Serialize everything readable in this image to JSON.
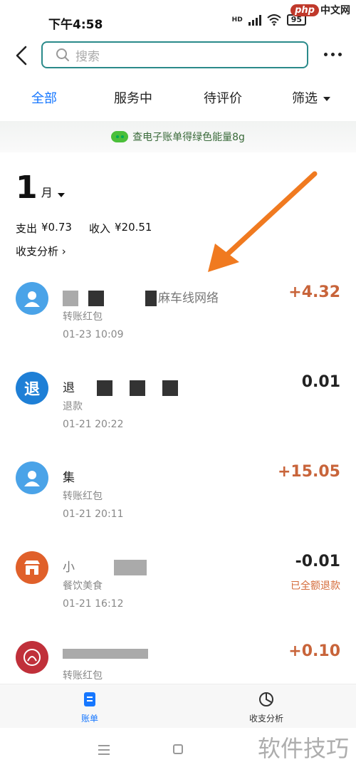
{
  "status_bar": {
    "time": "下午4:58",
    "network": "HD",
    "battery": "95",
    "watermark_logo": "php",
    "watermark_logo_text": "中文网"
  },
  "header": {
    "search_placeholder": "搜索",
    "back_icon": "chevron-left-icon",
    "more_icon": "more-dots-icon"
  },
  "tabs": [
    {
      "label": "全部",
      "active": true
    },
    {
      "label": "服务中",
      "active": false
    },
    {
      "label": "待评价",
      "active": false
    },
    {
      "label": "筛选",
      "active": false
    }
  ],
  "banner": {
    "text": "查电子账单得绿色能量8g"
  },
  "month": {
    "number": "1",
    "unit": "月"
  },
  "summary": {
    "expense_label": "支出",
    "expense_value": "¥0.73",
    "income_label": "收入",
    "income_value": "¥20.51",
    "analysis_link": "收支分析 ›"
  },
  "transactions": [
    {
      "name_visible": "麻车线网络",
      "category": "转账红包",
      "time": "01-23  10:09",
      "amount": "+4.32",
      "note": "",
      "avatar": "user-icon",
      "avatar_color": "#4aa3e8"
    },
    {
      "name_visible": "退",
      "category": "退款",
      "time": "01-21  20:22",
      "amount": "0.01",
      "note": "",
      "avatar": "refund-icon",
      "avatar_text": "退",
      "avatar_color": "#1e7fd6"
    },
    {
      "name_visible": "集",
      "category": "转账红包",
      "time": "01-21  20:11",
      "amount": "+15.05",
      "note": "",
      "avatar": "user-icon",
      "avatar_color": "#4aa3e8"
    },
    {
      "name_visible": "小",
      "category": "餐饮美食",
      "time": "01-21  16:12",
      "amount": "-0.01",
      "note": "已全额退款",
      "avatar": "shop-icon",
      "avatar_color": "#e0602a"
    },
    {
      "name_visible": "",
      "category": "转账红包",
      "time": "",
      "amount": "+0.10",
      "note": "",
      "avatar": "merchant-icon",
      "avatar_color": "#c0303a"
    }
  ],
  "bottom_nav": [
    {
      "label": "账单",
      "icon": "bill-icon",
      "active": true
    },
    {
      "label": "收支分析",
      "icon": "pie-chart-icon",
      "active": false
    }
  ],
  "system_nav": {
    "watermark_text": "软件技巧"
  },
  "colors": {
    "accent": "#1677ff",
    "income": "#c8643a",
    "search_border": "#2a8a8a",
    "arrow": "#f07a20"
  }
}
